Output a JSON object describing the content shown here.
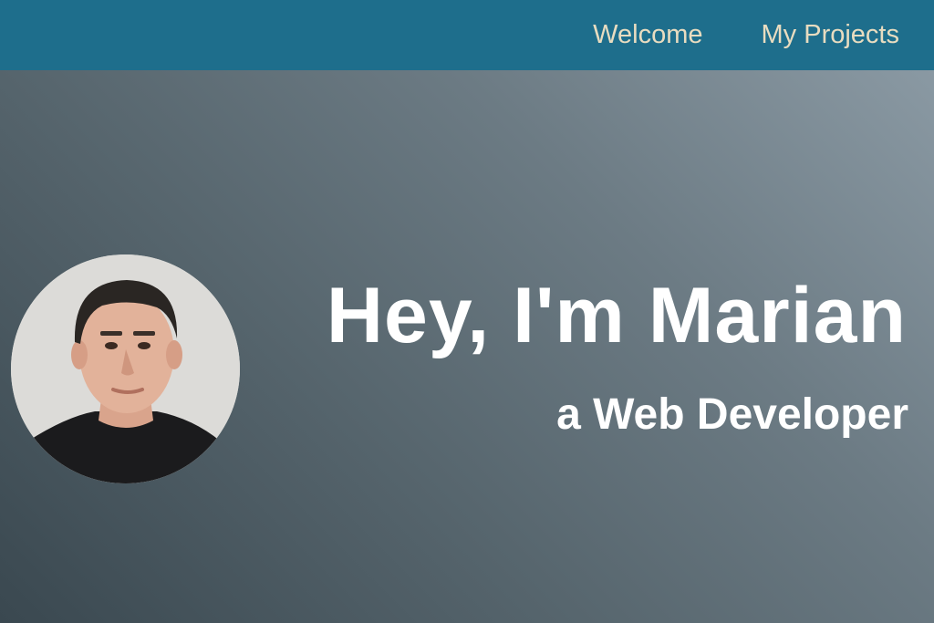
{
  "nav": {
    "items": [
      {
        "label": "Welcome"
      },
      {
        "label": "My Projects"
      }
    ]
  },
  "hero": {
    "title": "Hey, I'm Marian",
    "subtitle": "a Web Developer",
    "avatar_icon": "profile-photo"
  },
  "colors": {
    "navbar": "#1e6e8c",
    "nav_text": "#e8dcc0",
    "hero_gradient_light": "#8a99a3",
    "hero_gradient_dark": "#3a4850",
    "hero_text": "#ffffff"
  }
}
